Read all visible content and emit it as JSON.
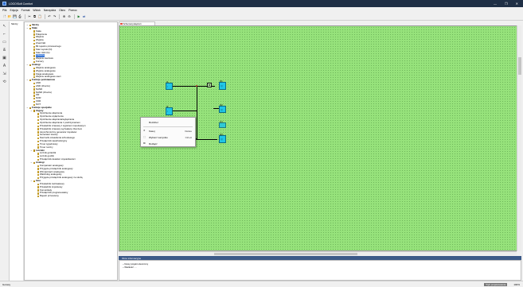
{
  "window": {
    "title": "LOGO!Soft Comfort",
    "controls": [
      "—",
      "❐",
      "✕"
    ]
  },
  "menu": [
    "Plik",
    "Edycja",
    "Format",
    "Widok",
    "Narzędzia",
    "Okno",
    "Pomoc"
  ],
  "toolbar_icons": [
    "new-icon",
    "open-icon",
    "save-icon",
    "print-icon",
    "sep",
    "cut-icon",
    "copy-icon",
    "paste-icon",
    "sep",
    "undo-icon",
    "redo-icon",
    "sep",
    "zoom-in-icon",
    "zoom-out-icon",
    "sep",
    "simulation-icon",
    "transfer-icon"
  ],
  "tree_header": "Skróty",
  "tree": [
    {
      "label": "Skróty",
      "type": "cat",
      "indent": 0
    },
    {
      "label": "Stałe",
      "type": "cat",
      "indent": 0
    },
    {
      "label": "Stała",
      "type": "item",
      "indent": 1
    },
    {
      "label": "Połączenie",
      "type": "item",
      "indent": 1
    },
    {
      "label": "Wejście",
      "type": "item",
      "indent": 1
    },
    {
      "label": "Wyjście",
      "type": "item",
      "indent": 1
    },
    {
      "label": "Znaczniki",
      "type": "item",
      "indent": 1
    },
    {
      "label": "Bit rejestru przesuwnego",
      "type": "item",
      "indent": 1
    },
    {
      "label": "Stan wysoki (hi)",
      "type": "item",
      "indent": 1
    },
    {
      "label": "Stan niski (lo)",
      "type": "item",
      "indent": 1
    },
    {
      "label": "Otwarte",
      "type": "item",
      "indent": 1,
      "selected": true
    },
    {
      "label": "Wejście sieciowe",
      "type": "item",
      "indent": 1
    },
    {
      "label": "Kursory",
      "type": "item",
      "indent": 1
    },
    {
      "label": "Analogi",
      "type": "cat",
      "indent": 0
    },
    {
      "label": "Wejście analogowe",
      "type": "item",
      "indent": 1
    },
    {
      "label": "Wyjście analogowe",
      "type": "item",
      "indent": 1
    },
    {
      "label": "Flaga analogowa",
      "type": "item",
      "indent": 1
    },
    {
      "label": "Wejście analogowe sieci",
      "type": "item",
      "indent": 1
    },
    {
      "label": "Funkcje podstawowe",
      "type": "cat",
      "indent": 0
    },
    {
      "label": "AND",
      "type": "item",
      "indent": 1
    },
    {
      "label": "AND (zbocze)",
      "type": "item",
      "indent": 1
    },
    {
      "label": "NAND",
      "type": "item",
      "indent": 1
    },
    {
      "label": "NAND (zbocze)",
      "type": "item",
      "indent": 1
    },
    {
      "label": "OR",
      "type": "item",
      "indent": 1
    },
    {
      "label": "NOR",
      "type": "item",
      "indent": 1
    },
    {
      "label": "XOR",
      "type": "item",
      "indent": 1
    },
    {
      "label": "NOT",
      "type": "item",
      "indent": 1
    },
    {
      "label": "Funkcje specjalne",
      "type": "cat",
      "indent": 0
    },
    {
      "label": "Zegary",
      "type": "cat",
      "indent": 1
    },
    {
      "label": "Opóźnienie włączenia",
      "type": "item",
      "indent": 2
    },
    {
      "label": "Opóźnienie wyłączenia",
      "type": "item",
      "indent": 2
    },
    {
      "label": "Opóźnienie włączania/wyłączania",
      "type": "item",
      "indent": 2
    },
    {
      "label": "Opóźnienie włączania z podtrzymaniem",
      "type": "item",
      "indent": 2
    },
    {
      "label": "Przekaźnik czasowy z wyjściem impulsowym",
      "type": "item",
      "indent": 2
    },
    {
      "label": "Przekaźnik czasowy wyzwalany zboczem",
      "type": "item",
      "indent": 2
    },
    {
      "label": "Asynchroniczny generator impulsów",
      "type": "item",
      "indent": 2
    },
    {
      "label": "Generator losowy",
      "type": "item",
      "indent": 2
    },
    {
      "label": "Nierzucik oświetlenia schodowego",
      "type": "item",
      "indent": 2
    },
    {
      "label": "Przełącznik wielofunkcyjny",
      "type": "item",
      "indent": 2
    },
    {
      "label": "Timer tygodniowy",
      "type": "item",
      "indent": 2
    },
    {
      "label": "Timer roczny",
      "type": "item",
      "indent": 2
    },
    {
      "label": "Liczniki",
      "type": "cat",
      "indent": 1
    },
    {
      "label": "Licznik góra/dół",
      "type": "item",
      "indent": 2
    },
    {
      "label": "Licznik godzin",
      "type": "item",
      "indent": 2
    },
    {
      "label": "Przełącznik detektor częstotliwości",
      "type": "item",
      "indent": 2
    },
    {
      "label": "Analogi",
      "type": "cat",
      "indent": 1
    },
    {
      "label": "Komparator analogowy",
      "type": "item",
      "indent": 2
    },
    {
      "label": "Przyjęcie przełącznik analogowy",
      "type": "item",
      "indent": 2
    },
    {
      "label": "Wzmacniacz analogowy",
      "type": "item",
      "indent": 2
    },
    {
      "label": "Watchdog analogowy",
      "type": "item",
      "indent": 2
    },
    {
      "label": "Przyjęcie przełącznik analogowy ze strefą",
      "type": "item",
      "indent": 2
    },
    {
      "label": "Inne",
      "type": "cat",
      "indent": 1
    },
    {
      "label": "Przekaźnik zatrzaskowy",
      "type": "item",
      "indent": 2
    },
    {
      "label": "Przekaźnik impulsowy",
      "type": "item",
      "indent": 2
    },
    {
      "label": "Komunikaty",
      "type": "item",
      "indent": 2
    },
    {
      "label": "Przełącznik programowalny",
      "type": "item",
      "indent": 2
    },
    {
      "label": "Rejestr przesuwny",
      "type": "item",
      "indent": 2
    }
  ],
  "document_tab": "Schemat połączeń",
  "blocks": [
    {
      "name": "Q1",
      "num": "Q1"
    },
    {
      "name": "I1",
      "num": "I1"
    },
    {
      "name": "Q2",
      "num": "Q2"
    },
    {
      "name": "I2",
      "num": "I2"
    },
    {
      "name": "Q3",
      "num": "Q3"
    },
    {
      "name": "Q4",
      "num": "Q4"
    },
    {
      "name": "B001",
      "num": "B001"
    }
  ],
  "context_menu": {
    "items": [
      {
        "label": "Rozdziel",
        "shortcut": "",
        "icon": ""
      },
      {
        "label": "Kasuj",
        "shortcut": "Delete",
        "icon": "delete-icon"
      },
      {
        "label": "Wybierz wszystko",
        "shortcut": "Ctrl+A",
        "icon": "select-all-icon"
      },
      {
        "label": "Rozłącz",
        "shortcut": "",
        "icon": "disconnect-icon"
      }
    ]
  },
  "output_window": {
    "title": "Okno informacyjne",
    "lines": [
      "~ Nowy projekt utworzony",
      "~ Wielkość: ..."
    ]
  },
  "status": {
    "left": "Gotowy",
    "right_mode": "Tryb projektowania",
    "right_zoom": "100%"
  }
}
